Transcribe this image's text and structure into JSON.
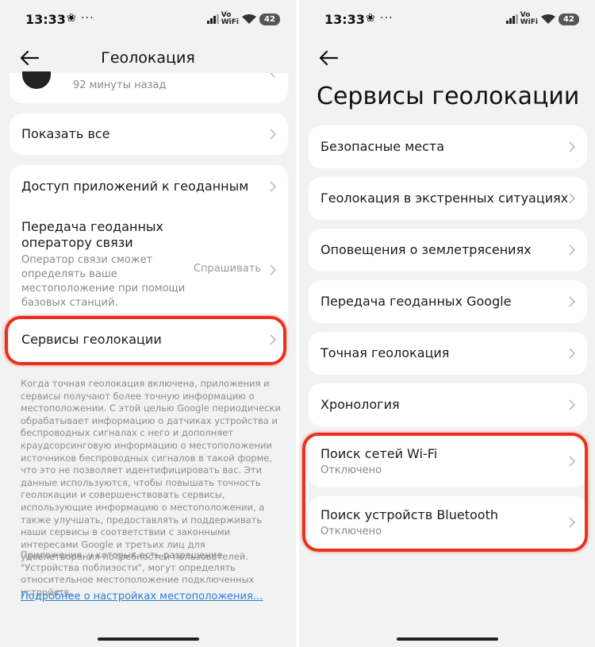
{
  "status": {
    "time": "13:33",
    "extra_icons": "❀ ···",
    "volte": "Vo\nWiFi",
    "battery": "42"
  },
  "left": {
    "title": "Геолокация",
    "partial_item": {
      "sub": "92 минуты назад"
    },
    "show_all": "Показать все",
    "items": [
      {
        "label": "Доступ приложений к геоданным"
      },
      {
        "label": "Передача геоданных оператору связи",
        "sub": "Оператор связи сможет определять ваше местоположение при помощи базовых станций.",
        "value": "Спрашивать"
      },
      {
        "label": "Сервисы геолокации"
      }
    ],
    "footnote1": "Когда точная геолокация включена, приложения и сервисы получают более точную информацию о местоположении. С этой целью Google периодически обрабатывает информацию о датчиках устройства и беспроводных сигналах с него и дополняет краудсорсинговую информацию о местоположении источников беспроводных сигналов в такой форме, что это не позволяет идентифицировать вас. Эти данные используются, чтобы повышать точность геолокации и совершенствовать сервисы, использующие информацию о местоположении, а также улучшать, предоставлять и поддерживать наши сервисы в соответствии с законными интересами Google и третьих лиц для удовлетворения потребностей пользователей.",
    "footnote2": "Приложения, у которых есть разрешение \"Устройства поблизости\", могут определять относительное местоположение подключенных устройств.",
    "link": "Подробнее о настройках местоположения…"
  },
  "right": {
    "title": "Сервисы геолокации",
    "items": [
      {
        "label": "Безопасные места"
      },
      {
        "label": "Геолокация в экстренных ситуациях"
      },
      {
        "label": "Оповещения о землетрясениях"
      },
      {
        "label": "Передача геоданных Google"
      },
      {
        "label": "Точная геолокация"
      },
      {
        "label": "Хронология"
      },
      {
        "label": "Поиск сетей Wi-Fi",
        "sub": "Отключено"
      },
      {
        "label": "Поиск устройств Bluetooth",
        "sub": "Отключено"
      }
    ]
  },
  "colors": {
    "highlight": "#e8321e",
    "link": "#2a7fd4",
    "background": "#f2f2f2"
  }
}
